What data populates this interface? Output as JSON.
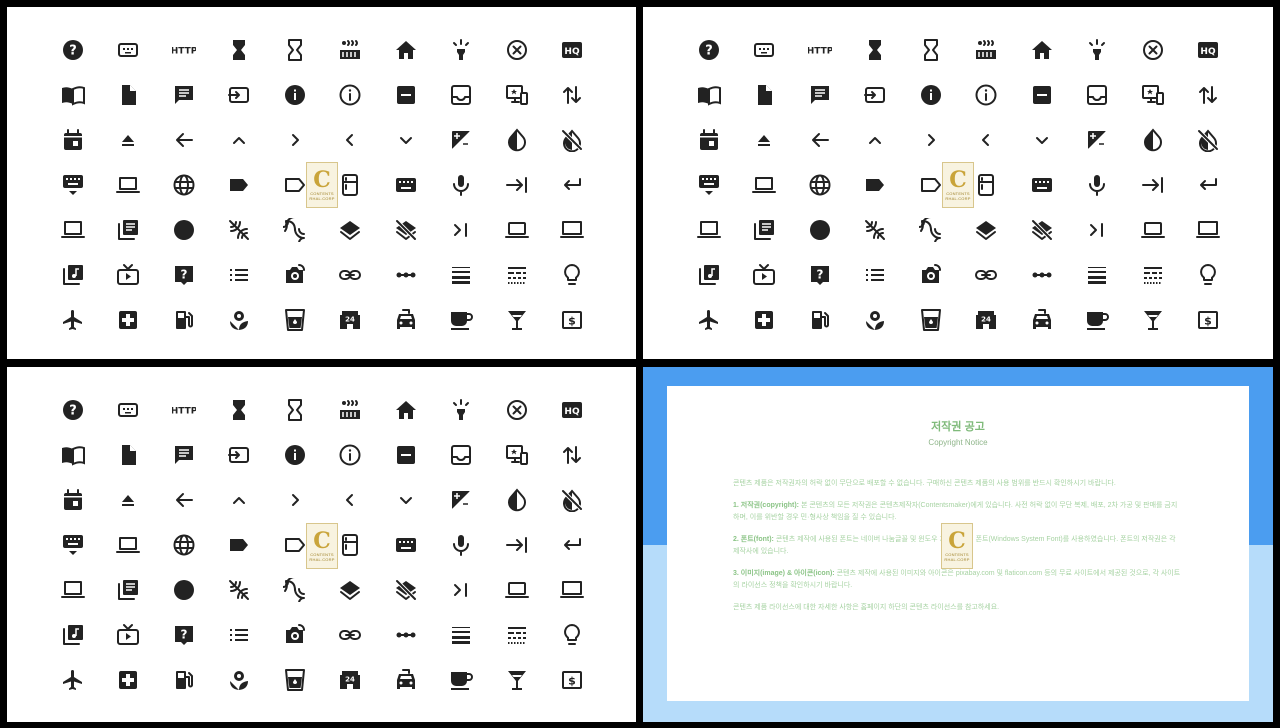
{
  "icon_rows": [
    [
      "help-circle-icon",
      "keyboard-dots-icon",
      "http-icon",
      "hourglass-full-icon",
      "hourglass-empty-icon",
      "hot-tub-icon",
      "home-icon",
      "highlight-icon",
      "highlight-off-icon",
      "hq-icon"
    ],
    [
      "import-contacts-icon",
      "insert-drive-file-icon",
      "insert-comment-icon",
      "input-icon",
      "info-icon",
      "info-outline-icon",
      "indeterminate-checkbox-icon",
      "inbox-icon",
      "important-devices-icon",
      "import-export-icon"
    ],
    [
      "insert-invitation-icon",
      "eject-icon",
      "arrow-back-icon",
      "chevron-up-icon",
      "chevron-right-icon",
      "chevron-left-icon",
      "chevron-down-icon",
      "exposure-icon",
      "invert-colors-icon",
      "invert-colors-off-icon"
    ],
    [
      "keyboard-hide-icon",
      "laptop-icon",
      "language-icon",
      "label-icon",
      "label-outline-icon",
      "kitchen-icon",
      "keyboard-icon",
      "mic-icon",
      "keyboard-tab-icon",
      "keyboard-return-icon"
    ],
    [
      "laptop-chromebook-icon",
      "library-books-icon",
      "lens-icon",
      "leak-remove-icon",
      "leak-add-icon",
      "layers-icon",
      "layers-clear-icon",
      "last-page-icon",
      "laptop-mac-icon",
      "laptop-windows-icon"
    ],
    [
      "library-music-icon",
      "live-tv-icon",
      "live-help-icon",
      "list-icon",
      "linked-camera-icon",
      "link-icon",
      "linear-scale-icon",
      "line-weight-icon",
      "line-style-icon",
      "lightbulb-icon"
    ],
    [
      "flight-icon",
      "local-hospital-icon",
      "local-gas-station-icon",
      "local-florist-icon",
      "local-drink-icon",
      "local-convenience-store-icon",
      "local-taxi-icon",
      "local-cafe-icon",
      "local-bar-icon",
      "local-atm-icon"
    ]
  ],
  "watermark": {
    "letter": "C",
    "text": "CONTENTS",
    "sub": "RHAL.CORP"
  },
  "labels": {
    "http": "HTTP",
    "hq": "HQ",
    "atm": "$",
    "store": "24"
  },
  "notice": {
    "title": "저작권 공고",
    "subtitle": "Copyright Notice",
    "intro": "콘텐츠 제품은 저작권자의 허락 없이 무단으로 배포할 수 없습니다. 구매하신 콘텐츠 제품의 사용 범위를 반드시 확인하시기 바랍니다.",
    "s1_head": "1. 저작권(copyright):",
    "s1_body": "본 콘텐츠의 모든 저작권은 콘텐츠제작자(Contentsmaker)에게 있습니다. 사전 허락 없이 무단 복제, 배포, 2차 가공 및 판매를 금지하며, 이를 위반할 경우 민·형사상 책임을 질 수 있습니다.",
    "s2_head": "2. 폰트(font):",
    "s2_body": "콘텐츠 제작에 사용된 폰트는 네이버 나눔글꼴 및 윈도우 기본 시스템 폰트(Windows System Font)를 사용하였습니다. 폰트의 저작권은 각 제작사에 있습니다.",
    "s3_head": "3. 이미지(image) & 아이콘(icon):",
    "s3_body": "콘텐츠 제작에 사용된 이미지와 아이콘은 pixabay.com 및 flaticon.com 등의 무료 사이트에서 제공된 것으로, 각 사이트의 라이선스 정책을 확인하시기 바랍니다.",
    "closing": "콘텐츠 제품 라이선스에 대한 자세한 사항은 홈페이지 하단의 콘텐츠 라이선스를 참고하세요."
  }
}
